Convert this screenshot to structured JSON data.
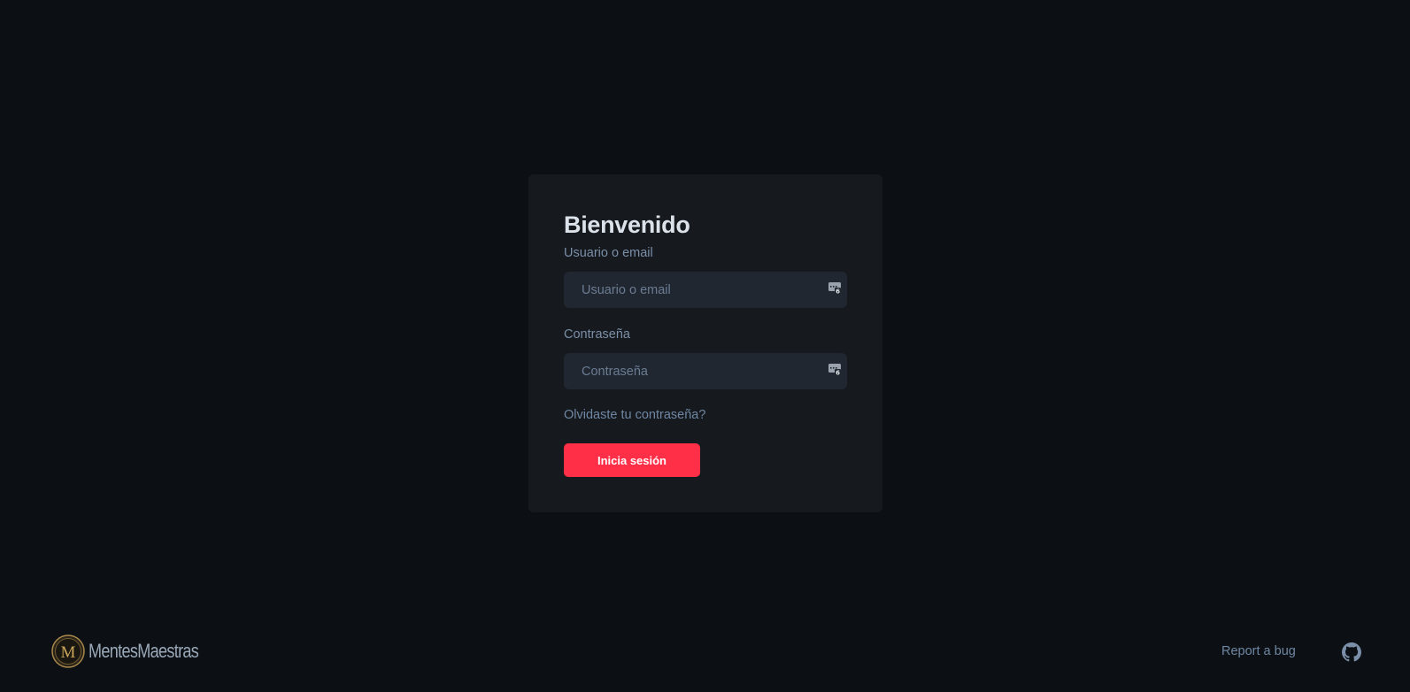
{
  "login": {
    "title": "Bienvenido",
    "username_label": "Usuario o email",
    "username_placeholder": "Usuario o email",
    "username_value": "",
    "password_label": "Contraseña",
    "password_placeholder": "Contraseña",
    "password_value": "",
    "forgot_link": "Olvidaste tu contraseña?",
    "submit_label": "Inicia sesión",
    "password_manager_icon": "password-manager-icon",
    "accent_color": "#ff2f48"
  },
  "footer": {
    "brand": "MentesMaestras",
    "logo_letter": "M",
    "report_link": "Report a bug",
    "github_icon": "github-icon"
  }
}
